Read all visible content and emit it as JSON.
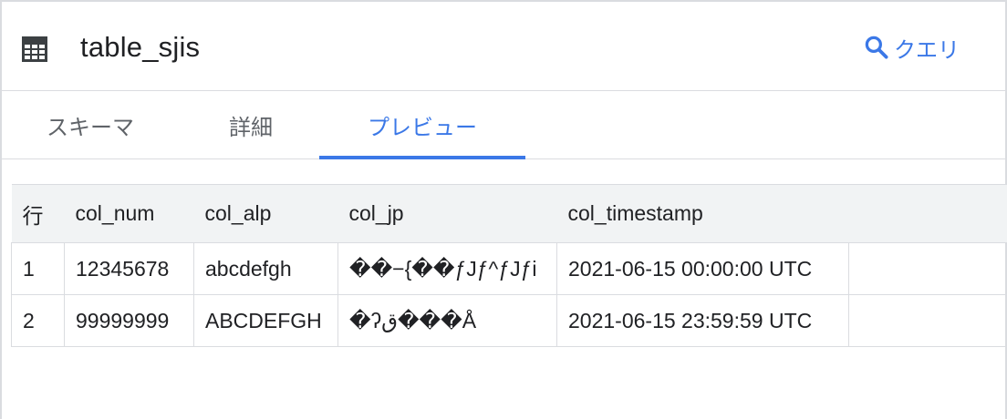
{
  "header": {
    "title": "table_sjis",
    "query_label": "クエリ"
  },
  "tabs": [
    {
      "label": "スキーマ",
      "active": false
    },
    {
      "label": "詳細",
      "active": false
    },
    {
      "label": "プレビュー",
      "active": true
    }
  ],
  "table": {
    "columns": [
      "行",
      "col_num",
      "col_alp",
      "col_jp",
      "col_timestamp"
    ],
    "rows": [
      [
        "1",
        "12345678",
        "abcdefgh",
        "��−{��ƒJƒ^ƒJƒi",
        "2021-06-15 00:00:00 UTC"
      ],
      [
        "2",
        "99999999",
        "ABCDEFGH",
        "�ʔق���Å",
        "2021-06-15 23:59:59 UTC"
      ]
    ]
  },
  "colors": {
    "accent": "#3b78e7",
    "header_bg": "#f1f3f4",
    "border": "#dadce0"
  },
  "icons": {
    "title_icon": "table-grid-icon",
    "query_icon": "search-icon"
  }
}
